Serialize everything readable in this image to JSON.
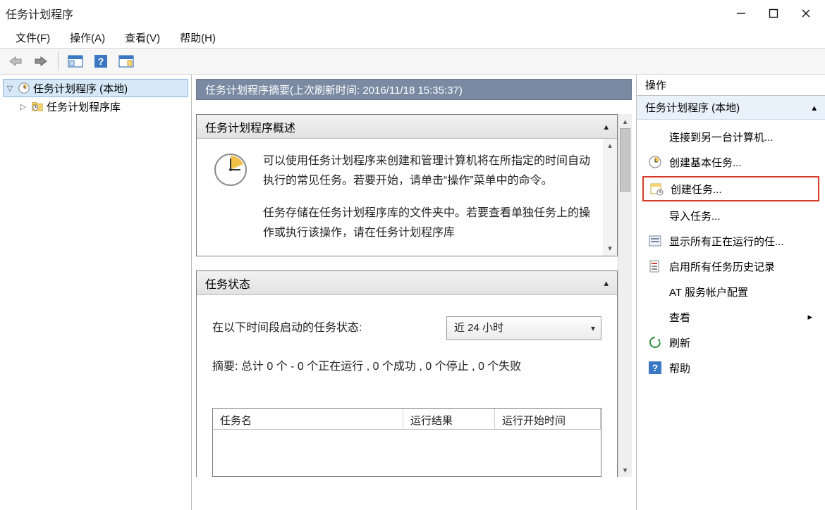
{
  "window": {
    "title": "任务计划程序"
  },
  "menu": {
    "file": "文件(F)",
    "action": "操作(A)",
    "view": "查看(V)",
    "help": "帮助(H)"
  },
  "tree": {
    "root": "任务计划程序 (本地)",
    "library": "任务计划程序库"
  },
  "summary": {
    "header": "任务计划程序摘要(上次刷新时间: 2016/11/18 15:35:37)"
  },
  "overview": {
    "title": "任务计划程序概述",
    "p1": "可以使用任务计划程序来创建和管理计算机将在所指定的时间自动执行的常见任务。若要开始，请单击“操作”菜单中的命令。",
    "p2": "任务存储在任务计划程序库的文件夹中。若要查看单独任务上的操作或执行该操作，请在任务计划程序库"
  },
  "status": {
    "title": "任务状态",
    "range_label": "在以下时间段启动的任务状态:",
    "range_value": "近 24 小时",
    "summary_line": "摘要: 总计 0 个 - 0 个正在运行 , 0 个成功 , 0 个停止 , 0 个失败",
    "col_name": "任务名",
    "col_result": "运行结果",
    "col_start": "运行开始时间"
  },
  "actions": {
    "pane_title": "操作",
    "context": "任务计划程序 (本地)",
    "items": {
      "connect": "连接到另一台计算机...",
      "create_basic": "创建基本任务...",
      "create_task": "创建任务...",
      "import": "导入任务...",
      "show_running": "显示所有正在运行的任...",
      "enable_history": "启用所有任务历史记录",
      "at_account": "AT 服务帐户配置",
      "view": "查看",
      "refresh": "刷新",
      "help": "帮助"
    }
  }
}
